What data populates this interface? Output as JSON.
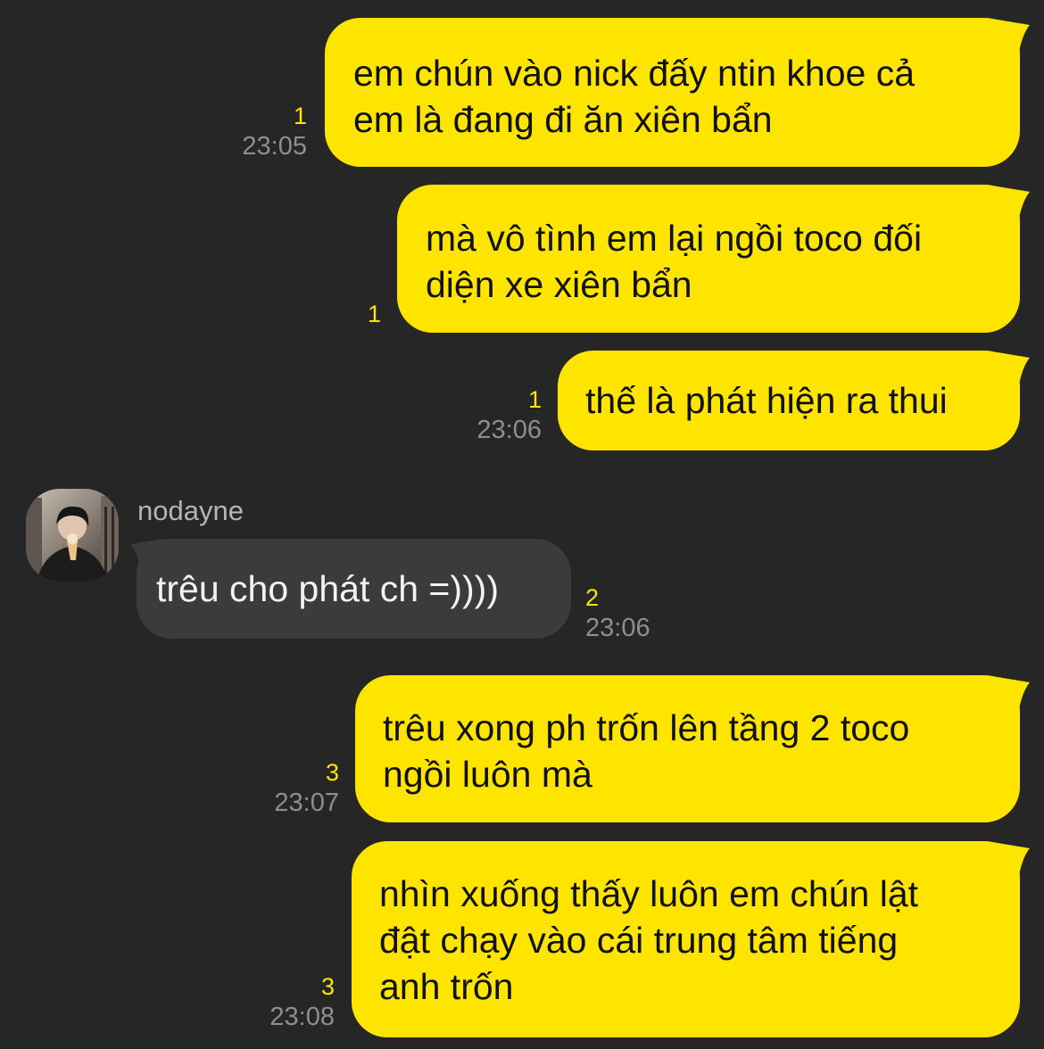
{
  "colors": {
    "background": "#262626",
    "outgoing_bubble": "#fee500",
    "incoming_bubble": "#3b3b3b",
    "unread_count": "#fee500",
    "timestamp": "#8e8e8e"
  },
  "messages": [
    {
      "direction": "out",
      "lines": [
        "em chún vào nick đấy ntin khoe cả",
        "em là đang đi ăn xiên bẩn"
      ],
      "unread": "1",
      "time": "23:05"
    },
    {
      "direction": "out",
      "lines": [
        "mà vô tình em lại ngồi toco đối",
        "diện xe xiên bẩn"
      ],
      "unread": "1",
      "time": ""
    },
    {
      "direction": "out",
      "lines": [
        "thế là phát hiện ra thui"
      ],
      "unread": "1",
      "time": "23:06"
    },
    {
      "direction": "in",
      "sender": "nodayne",
      "avatar_icon": "profile-photo-avatar",
      "lines": [
        "trêu cho phát ch =))))"
      ],
      "unread": "2",
      "time": "23:06"
    },
    {
      "direction": "out",
      "lines": [
        "trêu xong ph trốn lên tầng 2 toco",
        "ngồi luôn mà"
      ],
      "unread": "3",
      "time": "23:07"
    },
    {
      "direction": "out",
      "lines": [
        "nhìn xuống thấy luôn em chún lật",
        "đật chạy vào cái trung tâm tiếng",
        "anh trốn"
      ],
      "unread": "3",
      "time": "23:08"
    }
  ]
}
